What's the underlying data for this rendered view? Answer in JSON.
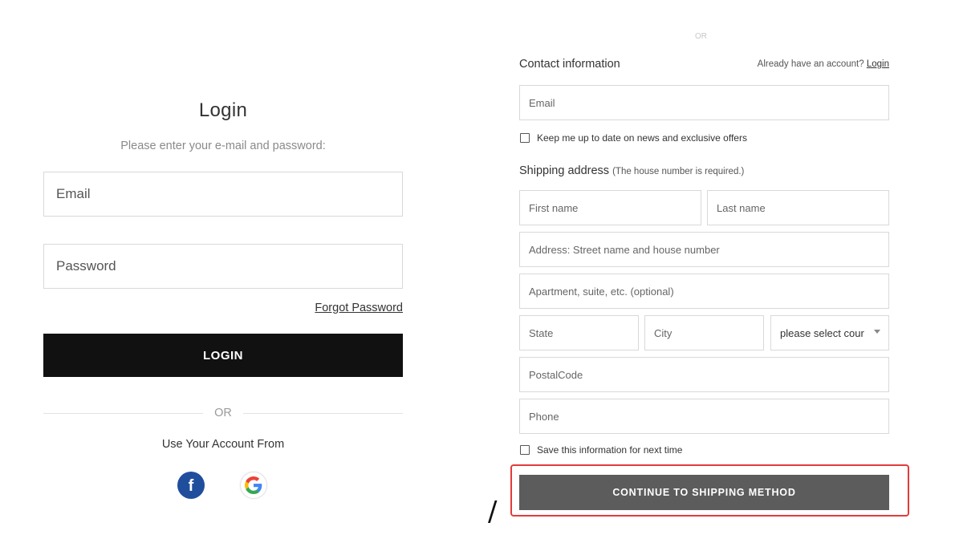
{
  "login": {
    "title": "Login",
    "subtitle": "Please enter your e-mail and password:",
    "email_placeholder": "Email",
    "password_placeholder": "Password",
    "forgot_label": "Forgot Password",
    "login_button": "LOGIN",
    "or_label": "OR",
    "use_account_label": "Use Your Account From",
    "social": [
      {
        "name": "facebook",
        "glyph": "f",
        "color": "#1f4e9c"
      },
      {
        "name": "google",
        "glyph": "G",
        "color": "#4285f4"
      }
    ]
  },
  "checkout": {
    "or_faded": "OR",
    "contact_title": "Contact information",
    "already_text": "Already have an account?",
    "already_link": "Login",
    "email_placeholder": "Email",
    "keep_updated_label": "Keep me up to date on news and exclusive offers",
    "shipping_title": "Shipping address",
    "shipping_note": "(The house number is required.)",
    "first_name_placeholder": "First name",
    "last_name_placeholder": "Last name",
    "address_placeholder": "Address: Street name and house number",
    "apartment_placeholder": "Apartment, suite, etc. (optional)",
    "state_placeholder": "State",
    "city_placeholder": "City",
    "country_selected": "please select cour",
    "postal_placeholder": "PostalCode",
    "phone_placeholder": "Phone",
    "save_info_label": "Save this information for next time",
    "continue_button": "CONTINUE TO SHIPPING METHOD",
    "highlight_color": "#e33b3b"
  },
  "annotation": {
    "slash_mark": "/"
  }
}
